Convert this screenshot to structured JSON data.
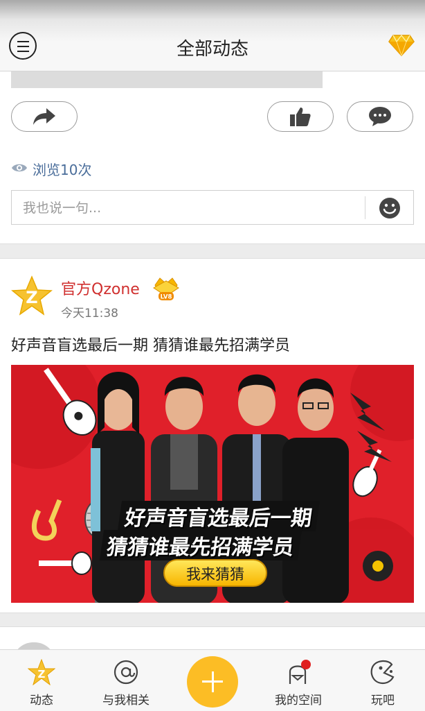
{
  "header": {
    "title": "全部动态",
    "menu_icon": "menu-icon",
    "vip_icon": "diamond-icon"
  },
  "feed": {
    "card1": {
      "views_text": "浏览10次",
      "comment_placeholder": "我也说一句...",
      "actions": [
        "share-icon",
        "like-icon",
        "comment-icon"
      ]
    },
    "card2": {
      "author": "官方Qzone",
      "level_badge": "LV8",
      "time": "今天11:38",
      "text": "好声音盲选最后一期 猜猜谁最先招满学员",
      "banner": {
        "headline_1": "好声音盲选最后一期",
        "headline_2": "猜猜谁最先招满学员",
        "button": "我来猜猜"
      }
    }
  },
  "bottom_nav": {
    "items": [
      {
        "label": "动态",
        "icon": "star-icon"
      },
      {
        "label": "与我相关",
        "icon": "at-icon"
      },
      {
        "label": "我的空间",
        "icon": "profile-icon"
      },
      {
        "label": "玩吧",
        "icon": "game-icon"
      }
    ]
  },
  "colors": {
    "accent": "#fcbd25",
    "author": "#d0302f",
    "link": "#4a6d9a",
    "banner_bg": "#e0202a"
  }
}
